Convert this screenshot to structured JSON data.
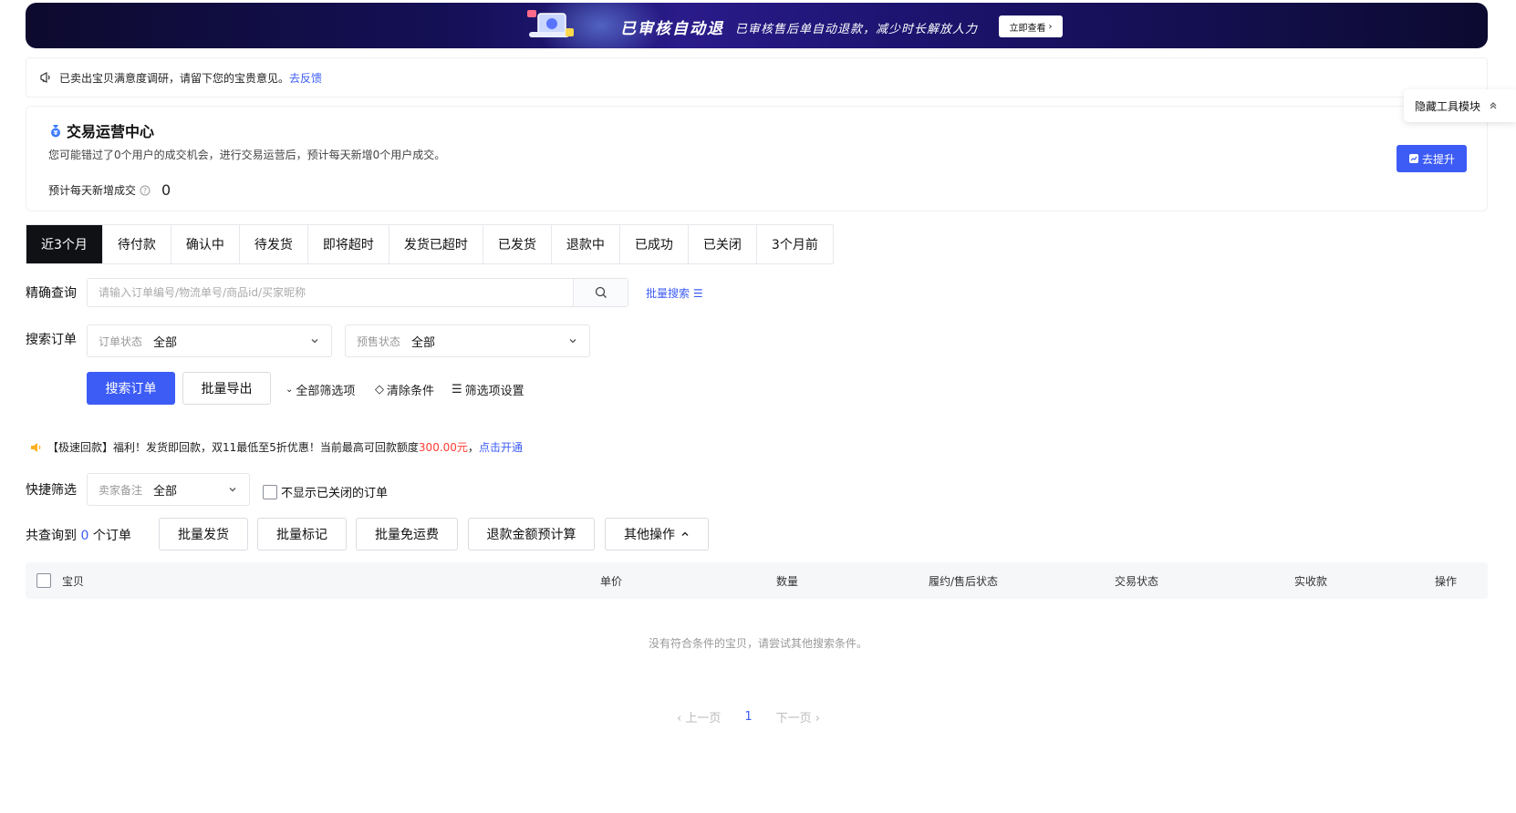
{
  "banner": {
    "title": "已审核自动退",
    "subtitle": "已审核售后单自动退款，减少时长解放人力",
    "cta": "立即查看"
  },
  "survey": {
    "text": "已卖出宝贝满意度调研，请留下您的宝贵意见。",
    "link": "去反馈"
  },
  "ops": {
    "title": "交易运营中心",
    "desc": "您可能错过了0个用户的成交机会，进行交易运营后，预计每天新增0个用户成交。",
    "metric_label": "预计每天新增成交",
    "metric_value": "0",
    "button": "去提升"
  },
  "hide_tools": "隐藏工具模块",
  "tabs": [
    "近3个月",
    "待付款",
    "确认中",
    "待发货",
    "即将超时",
    "发货已超时",
    "已发货",
    "退款中",
    "已成功",
    "已关闭",
    "3个月前"
  ],
  "precise": {
    "label": "精确查询",
    "placeholder": "请输入订单编号/物流单号/商品id/买家昵称",
    "batch": "批量搜索"
  },
  "order_search": {
    "label": "搜索订单",
    "status_key": "订单状态",
    "status_val": "全部",
    "presale_key": "预售状态",
    "presale_val": "全部"
  },
  "actions": {
    "search": "搜索订单",
    "export": "批量导出",
    "all_filters": "全部筛选项",
    "clear": "清除条件",
    "filter_settings": "筛选项设置"
  },
  "promo": {
    "prefix": "【极速回款】福利！发货即回款，双11最低至5折优惠！当前最高可回款额度",
    "amount": "300.00元",
    "suffix": "，",
    "link": "点击开通"
  },
  "quick": {
    "label": "快捷筛选",
    "remark_key": "卖家备注",
    "remark_val": "全部",
    "hide_closed": "不显示已关闭的订单"
  },
  "count": {
    "prefix": "共查询到",
    "num": "0",
    "suffix": "个订单"
  },
  "bulk": {
    "ship": "批量发货",
    "mark": "批量标记",
    "free_ship": "批量免运费",
    "refund_calc": "退款金额预计算",
    "other": "其他操作"
  },
  "table": {
    "cols": {
      "item": "宝贝",
      "price": "单价",
      "qty": "数量",
      "fulfill": "履约/售后状态",
      "status": "交易状态",
      "paid": "实收款",
      "ops": "操作"
    },
    "empty": "没有符合条件的宝贝，请尝试其他搜索条件。"
  },
  "pager": {
    "prev": "上一页",
    "current": "1",
    "next": "下一页"
  }
}
